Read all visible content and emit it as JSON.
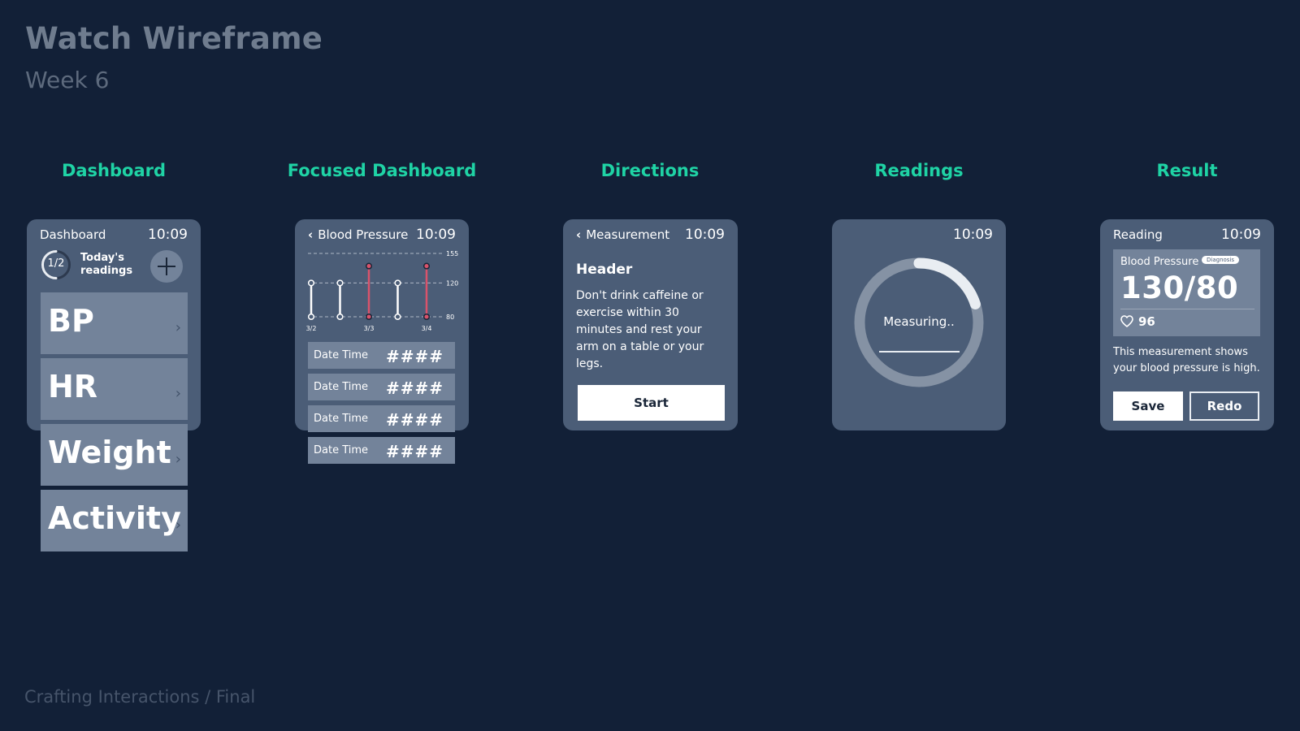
{
  "page": {
    "title": "Watch Wireframe",
    "subtitle": "Week 6",
    "footer": "Crafting Interactions / Final"
  },
  "columns": [
    "Dashboard",
    "Focused Dashboard",
    "Directions",
    "Readings",
    "Result"
  ],
  "time": "10:09",
  "dashboard": {
    "header": "Dashboard",
    "progress": "1/2",
    "progress_fraction": 0.5,
    "today_label": "Today's\nreadings",
    "tiles": [
      {
        "label": "BP"
      },
      {
        "label": "HR"
      },
      {
        "label": "Weight"
      },
      {
        "label": "Activity"
      }
    ]
  },
  "focused": {
    "header": "Blood Pressure",
    "rows": [
      {
        "label": "Date Time",
        "value": "####"
      },
      {
        "label": "Date Time",
        "value": "####"
      },
      {
        "label": "Date Time",
        "value": "####"
      },
      {
        "label": "Date Time",
        "value": "####"
      }
    ]
  },
  "chart_data": {
    "type": "range",
    "title": "",
    "categories": [
      "3/2",
      "",
      "3/3",
      "",
      "3/4"
    ],
    "yticks": [
      155,
      120,
      80
    ],
    "ylim": [
      80,
      155
    ],
    "series": [
      {
        "low": 80,
        "high": 120,
        "status": "normal"
      },
      {
        "low": 80,
        "high": 120,
        "status": "normal"
      },
      {
        "low": 80,
        "high": 140,
        "status": "high"
      },
      {
        "low": 80,
        "high": 120,
        "status": "normal"
      },
      {
        "low": 80,
        "high": 140,
        "status": "high"
      }
    ],
    "colors": {
      "normal": "#ffffff",
      "high": "#d9536b"
    },
    "grid": true
  },
  "directions": {
    "header": "Measurement",
    "heading": "Header",
    "body": "Don't drink caffeine or exercise within 30 minutes and rest your arm on a table or your legs.",
    "button": "Start"
  },
  "readings": {
    "label": "Measuring..",
    "progress_fraction": 0.2
  },
  "result": {
    "header": "Reading",
    "card_title": "Blood Pressure",
    "badge": "Diagnosis",
    "value": "130/80",
    "heart_rate": "96",
    "text": "This measurement shows your blood pressure is high.",
    "save": "Save",
    "redo": "Redo"
  },
  "colors": {
    "background": "#122037",
    "panel": "#4b5d77",
    "tile": "#73839a",
    "accent": "#1fd3a5",
    "alert": "#d9536b"
  }
}
